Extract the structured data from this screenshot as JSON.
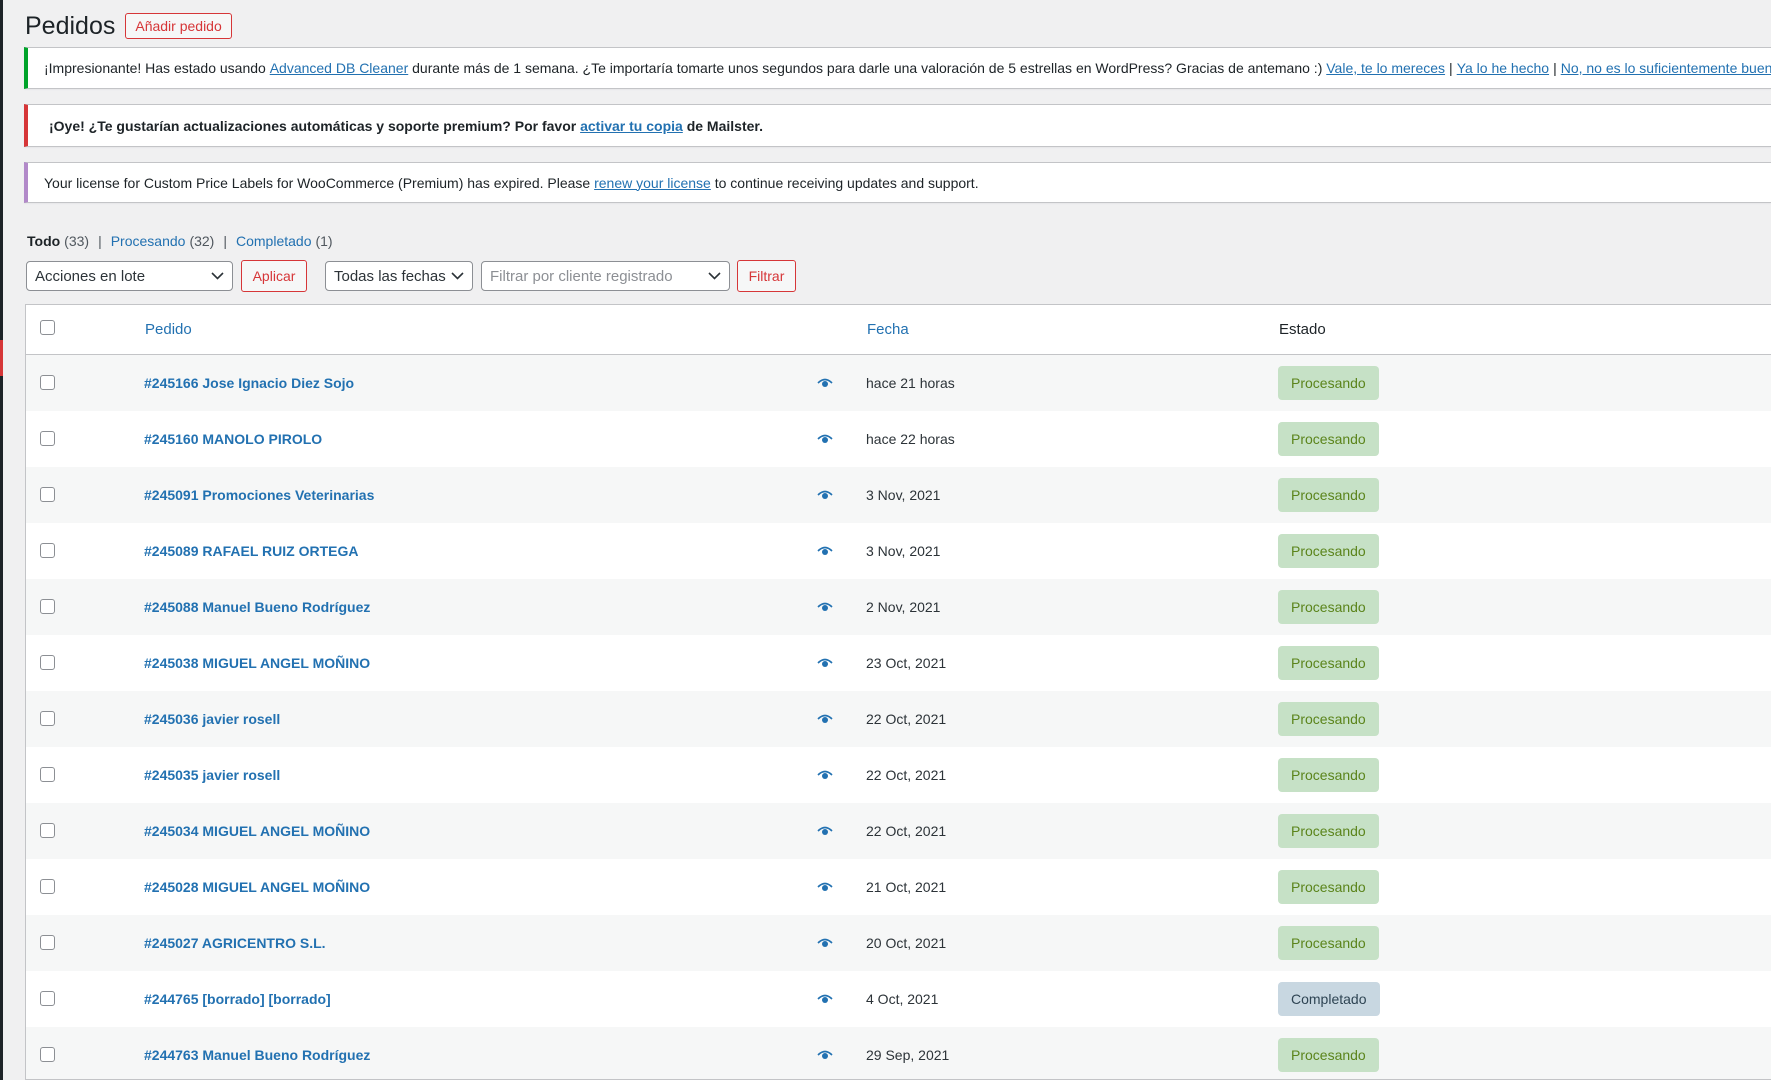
{
  "header": {
    "title": "Pedidos",
    "add_button": "Añadir pedido"
  },
  "notices": {
    "adb": {
      "text_before": "¡Impresionante! Has estado usando ",
      "link_plugin": "Advanced DB Cleaner",
      "text_after": " durante más de 1 semana. ¿Te importaría tomarte unos segundos para darle una valoración de 5 estrellas en WordPress? Gracias de antemano :) ",
      "link_yes": "Vale, te lo mereces ",
      "link_done": "Ya lo he hecho",
      "link_no": "No, no es lo suficientemente bueno"
    },
    "mailster": {
      "text_before": "¡Oye! ¿Te gustarían actualizaciones automáticas y soporte premium? Por favor ",
      "link": "activar tu copia",
      "text_after": " de Mailster."
    },
    "license": {
      "text_before": "Your license for Custom Price Labels for WooCommerce (Premium) has expired. Please ",
      "link": "renew your license",
      "text_after": " to continue receiving updates and support."
    }
  },
  "filters": {
    "all": {
      "label": "Todo",
      "count": "(33)"
    },
    "processing": {
      "label": "Procesando",
      "count": "(32)"
    },
    "completed": {
      "label": "Completado",
      "count": "(1)"
    }
  },
  "tablenav": {
    "bulk_actions": "Acciones en lote",
    "apply": "Aplicar",
    "dates": "Todas las fechas",
    "customer_placeholder": "Filtrar por cliente registrado",
    "filter": "Filtrar"
  },
  "table": {
    "columns": {
      "order": "Pedido",
      "date": "Fecha",
      "status": "Estado"
    },
    "rows": [
      {
        "order": "#245166 Jose Ignacio Diez Sojo",
        "date": "hace 21 horas",
        "status": "Procesando"
      },
      {
        "order": "#245160 MANOLO PIROLO",
        "date": "hace 22 horas",
        "status": "Procesando"
      },
      {
        "order": "#245091 Promociones Veterinarias",
        "date": "3 Nov, 2021",
        "status": "Procesando"
      },
      {
        "order": "#245089 RAFAEL RUIZ ORTEGA",
        "date": "3 Nov, 2021",
        "status": "Procesando"
      },
      {
        "order": "#245088 Manuel Bueno Rodríguez",
        "date": "2 Nov, 2021",
        "status": "Procesando"
      },
      {
        "order": "#245038 MIGUEL ANGEL MOÑINO",
        "date": "23 Oct, 2021",
        "status": "Procesando"
      },
      {
        "order": "#245036 javier rosell",
        "date": "22 Oct, 2021",
        "status": "Procesando"
      },
      {
        "order": "#245035 javier rosell",
        "date": "22 Oct, 2021",
        "status": "Procesando"
      },
      {
        "order": "#245034 MIGUEL ANGEL MOÑINO",
        "date": "22 Oct, 2021",
        "status": "Procesando"
      },
      {
        "order": "#245028 MIGUEL ANGEL MOÑINO",
        "date": "21 Oct, 2021",
        "status": "Procesando"
      },
      {
        "order": "#245027 AGRICENTRO S.L.",
        "date": "20 Oct, 2021",
        "status": "Procesando"
      },
      {
        "order": "#244765 [borrado] [borrado]",
        "date": "4 Oct, 2021",
        "status": "Completado"
      },
      {
        "order": "#244763 Manuel Bueno Rodríguez",
        "date": "29 Sep, 2021",
        "status": "Procesando"
      }
    ]
  },
  "colors": {
    "link": "#2271b1",
    "accent_red": "#d63638",
    "success_green": "#00a32a",
    "processing_bg": "#c6e1c6",
    "completed_bg": "#c8d7e1"
  }
}
